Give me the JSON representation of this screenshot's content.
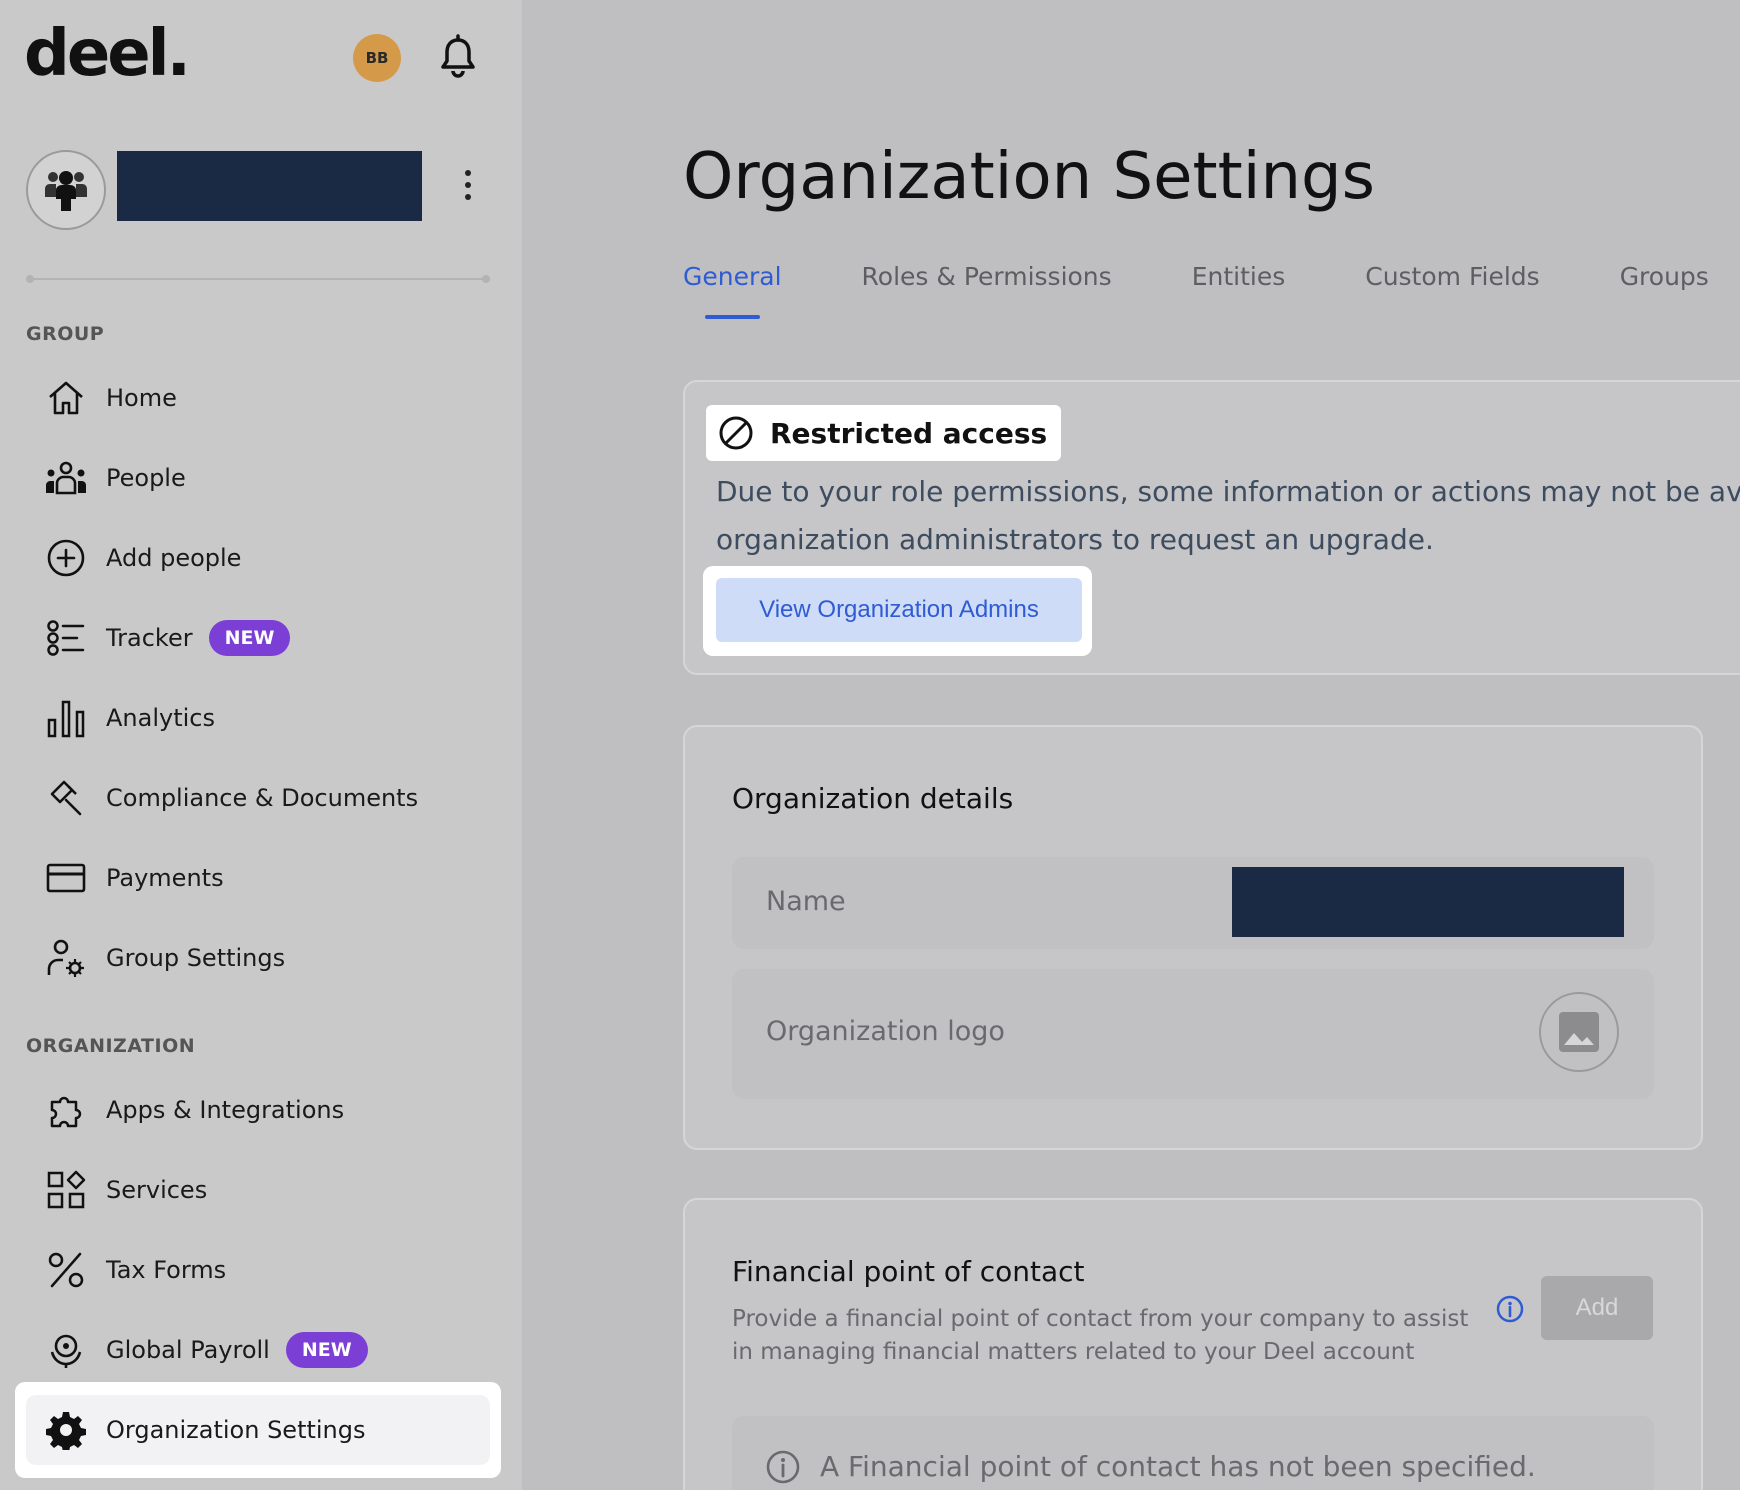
{
  "sidebar": {
    "logo": "deel.",
    "user_initials": "BB",
    "group_label": "GROUP",
    "group_items": [
      {
        "label": "Home",
        "icon": "home-icon"
      },
      {
        "label": "People",
        "icon": "people-icon"
      },
      {
        "label": "Add people",
        "icon": "plus-circle-icon"
      },
      {
        "label": "Tracker",
        "icon": "tracker-icon",
        "badge": "NEW"
      },
      {
        "label": "Analytics",
        "icon": "bar-chart-icon"
      },
      {
        "label": "Compliance & Documents",
        "icon": "gavel-icon"
      },
      {
        "label": "Payments",
        "icon": "credit-card-icon"
      },
      {
        "label": "Group Settings",
        "icon": "user-gear-icon"
      }
    ],
    "org_label": "ORGANIZATION",
    "org_items": [
      {
        "label": "Apps & Integrations",
        "icon": "puzzle-icon"
      },
      {
        "label": "Services",
        "icon": "services-grid-icon"
      },
      {
        "label": "Tax Forms",
        "icon": "percent-icon"
      },
      {
        "label": "Global Payroll",
        "icon": "global-payroll-icon",
        "badge": "NEW"
      },
      {
        "label": "Organization Settings",
        "icon": "gear-icon"
      }
    ]
  },
  "main": {
    "title": "Organization Settings",
    "tabs": [
      "General",
      "Roles & Permissions",
      "Entities",
      "Custom Fields",
      "Groups"
    ],
    "restricted": {
      "title": "Restricted access",
      "text_line1": "Due to your role permissions, some information or actions may not be available",
      "text_line2": "organization administrators to request an upgrade.",
      "button": "View Organization Admins"
    },
    "details": {
      "title": "Organization details",
      "name_label": "Name",
      "logo_label": "Organization logo"
    },
    "finance": {
      "title": "Financial point of contact",
      "description": "Provide a financial point of contact from your company to assist in managing financial matters related to your Deel account",
      "add_button": "Add",
      "empty_text": "A Financial point of contact has not been specified."
    }
  },
  "colors": {
    "accent": "#2f5bd3",
    "badge": "#7b3fd6",
    "redaction": "#1b2a44",
    "avatar": "#d49a4a"
  }
}
